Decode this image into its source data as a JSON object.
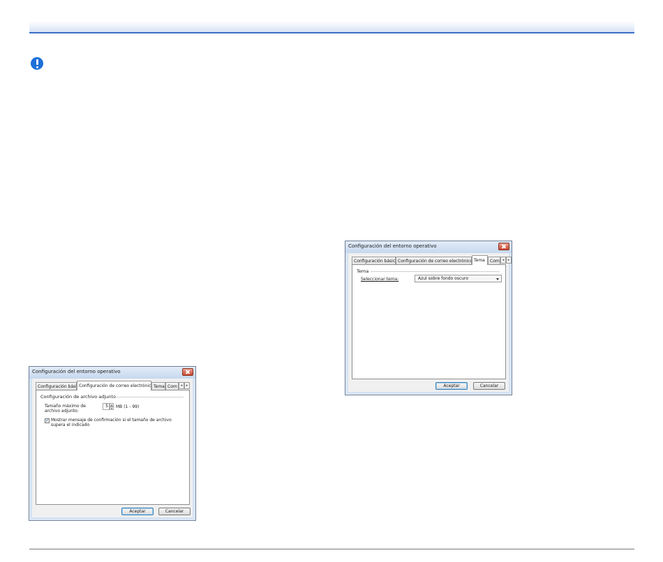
{
  "page": {
    "warning_icon": "exclamation-circle-icon",
    "accent_color": "#3a6fc4",
    "icon_color": "#1e6fd9"
  },
  "dialog_email": {
    "title": "Configuración del entorno operativo",
    "tabs": [
      {
        "label": "Configuración básica",
        "active": false
      },
      {
        "label": "Configuración de correo electrónico",
        "active": true
      },
      {
        "label": "Tema",
        "active": false
      },
      {
        "label": "Com",
        "active": false
      }
    ],
    "group_label": "Configuración de archivo adjunto",
    "max_size_label": "Tamaño máximo de archivo adjunto:",
    "max_size_value": "5",
    "max_size_unit": "MB (1 - 99)",
    "confirm_checkbox_label": "Mostrar mensaje de confirmación si el tamaño de archivo supera el indicado",
    "confirm_checked": true,
    "ok_label": "Aceptar",
    "cancel_label": "Cancelar"
  },
  "dialog_theme": {
    "title": "Configuración del entorno operativo",
    "tabs": [
      {
        "label": "Configuración básica",
        "active": false
      },
      {
        "label": "Configuración de correo electrónico",
        "active": false
      },
      {
        "label": "Tema",
        "active": true
      },
      {
        "label": "Com",
        "active": false
      }
    ],
    "group_label": "Tema",
    "select_label": "Seleccionar tema:",
    "selected_theme": "Azul sobre fondo oscuro",
    "ok_label": "Aceptar",
    "cancel_label": "Cancelar"
  }
}
